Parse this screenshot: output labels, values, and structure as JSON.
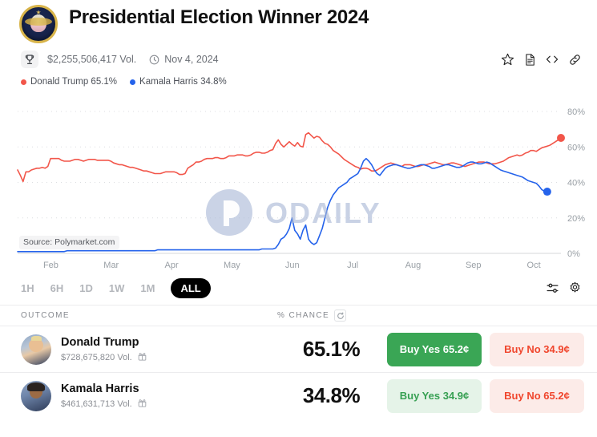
{
  "header": {
    "logo_icon": "presidential-seal-icon",
    "title": "Presidential Election Winner 2024"
  },
  "meta": {
    "trophy_icon": "trophy-icon",
    "volume": "$2,255,506,417 Vol.",
    "clock_icon": "clock-icon",
    "date": "Nov 4, 2024",
    "actions": [
      {
        "name": "star-icon",
        "label": "star"
      },
      {
        "name": "document-icon",
        "label": "document"
      },
      {
        "name": "code-icon",
        "label": "embed"
      },
      {
        "name": "link-icon",
        "label": "link"
      }
    ]
  },
  "legend": [
    {
      "label": "Donald Trump 65.1%",
      "color": "#f2564a"
    },
    {
      "label": "Kamala Harris 34.8%",
      "color": "#2563eb"
    }
  ],
  "chart_data": {
    "type": "line",
    "title": "",
    "xlabel": "",
    "ylabel": "",
    "ylim": [
      0,
      85
    ],
    "ytick_labels": [
      "0%",
      "20%",
      "40%",
      "60%",
      "80%"
    ],
    "ytick_values": [
      0,
      20,
      40,
      60,
      80
    ],
    "xtick_labels": [
      "Feb",
      "Mar",
      "Apr",
      "May",
      "Jun",
      "Jul",
      "Aug",
      "Sep",
      "Oct"
    ],
    "grid": "dotted-horizontal",
    "legend_position": "above-chart",
    "source_note": "Source: Polymarket.com",
    "watermark": "ODAILY",
    "series": [
      {
        "name": "Donald Trump",
        "color": "#f2564a",
        "end_value": 65.1,
        "values": [
          47,
          44,
          40.5,
          46,
          46,
          47,
          47.5,
          48,
          48,
          48.5,
          48,
          49,
          53.5,
          53.5,
          53.5,
          53.5,
          52.5,
          52,
          52,
          52,
          52.5,
          53,
          53,
          52.5,
          52,
          52.5,
          53,
          53,
          53,
          52.5,
          52.5,
          52.5,
          52.5,
          52.5,
          52,
          51,
          50.5,
          50,
          50,
          49.5,
          49,
          48.5,
          48.5,
          48,
          47.5,
          47,
          46.5,
          46.5,
          46,
          45.5,
          45,
          45,
          45,
          45.5,
          46,
          46,
          46,
          46,
          45.5,
          44.5,
          44.5,
          45,
          48,
          49,
          50,
          51.5,
          51.5,
          52,
          53,
          53.5,
          53.5,
          53.5,
          54,
          54,
          53.5,
          53.5,
          54,
          55,
          55,
          55,
          55.5,
          55.5,
          55.5,
          55,
          55,
          55.5,
          56.5,
          57,
          57,
          56.5,
          56.5,
          57,
          58,
          58.5,
          62,
          64,
          61.5,
          60,
          61.5,
          63,
          61.5,
          60.5,
          62.5,
          60.5,
          60,
          67,
          68,
          66.5,
          65,
          66,
          65.5,
          63.5,
          62,
          61.5,
          60,
          58,
          57,
          56,
          54.5,
          53,
          52,
          51,
          50,
          49,
          48.5,
          47.5,
          48,
          48,
          47.5,
          46.5,
          46.5,
          47,
          48,
          49,
          50,
          50.5,
          51,
          50.5,
          50,
          49.5,
          49,
          50,
          50,
          50,
          49.5,
          49,
          49,
          49.5,
          50,
          50,
          50.5,
          51,
          51.5,
          51,
          50.5,
          50,
          50,
          50.5,
          51,
          51,
          50.5,
          50,
          49.5,
          49,
          49.5,
          50,
          50.5,
          51,
          51.5,
          51.5,
          51.5,
          51,
          50.5,
          50.5,
          50.5,
          51,
          51.5,
          52,
          53,
          54,
          54.5,
          55,
          55.5,
          55,
          55.5,
          56.5,
          57,
          58,
          58,
          57.5,
          58.5,
          59.5,
          60,
          60.5,
          61,
          62,
          63,
          64,
          65.1
        ]
      },
      {
        "name": "Kamala Harris",
        "color": "#2563eb",
        "end_value": 34.8,
        "values": [
          1,
          1,
          1,
          1,
          1,
          1,
          1,
          1,
          1,
          1,
          1,
          1,
          1,
          1,
          1,
          1,
          1,
          1,
          1.5,
          1.5,
          1.5,
          1.5,
          1.5,
          1.5,
          1.5,
          1.5,
          1.5,
          1.5,
          1.5,
          1.5,
          1.5,
          1.5,
          1.5,
          1.5,
          1.5,
          1.5,
          1.5,
          1.5,
          1.5,
          1.5,
          1.5,
          1.5,
          1.5,
          1.5,
          1.5,
          1.5,
          1.5,
          1.5,
          1.5,
          1.5,
          1.5,
          2,
          2,
          2,
          2,
          2,
          2,
          2,
          2,
          2,
          2,
          2,
          2,
          2,
          2,
          2,
          2,
          2,
          2,
          2,
          2,
          2,
          2,
          2,
          2,
          2,
          2,
          2,
          2,
          2,
          2,
          2,
          2,
          2,
          2,
          2,
          2,
          2,
          2,
          2.5,
          2.5,
          2.5,
          2.5,
          2.5,
          3,
          5,
          8,
          9,
          11,
          14,
          20,
          13,
          11,
          8,
          13,
          16,
          8,
          6,
          5,
          6,
          10,
          14,
          20,
          26,
          30,
          33,
          35,
          37,
          38,
          39,
          40,
          42,
          43,
          44,
          45,
          48,
          52,
          53.5,
          52,
          50,
          47,
          45,
          44,
          46,
          48,
          49,
          49.5,
          50,
          50,
          49.5,
          49,
          48.5,
          48,
          48,
          48.5,
          49,
          49.5,
          50,
          50,
          49.5,
          49,
          48,
          48,
          48.5,
          49,
          49.5,
          50,
          50,
          49.5,
          49,
          48.5,
          48.5,
          49,
          50,
          51,
          51.5,
          51.5,
          51,
          50.5,
          50.5,
          51,
          51.5,
          51,
          50,
          49,
          48,
          47,
          46.5,
          46,
          45.5,
          45,
          44.5,
          44,
          43.5,
          43,
          42,
          41,
          40.5,
          40,
          39.5,
          38,
          36,
          35,
          34.8
        ]
      }
    ]
  },
  "ranges": {
    "buttons": [
      "1H",
      "6H",
      "1D",
      "1W",
      "1M",
      "ALL"
    ],
    "active": "ALL",
    "sliders_icon": "sliders-icon",
    "gear_icon": "gear-icon"
  },
  "table": {
    "col_outcome": "OUTCOME",
    "col_chance": "% CHANCE",
    "refresh_icon": "refresh-icon",
    "rows": [
      {
        "avatar_icon": "donald-trump-avatar",
        "name": "Donald Trump",
        "volume": "$728,675,820 Vol.",
        "gift_icon": "gift-icon",
        "percent": "65.1%",
        "buy_yes": "Buy Yes 65.2¢",
        "buy_no": "Buy No 34.9¢",
        "yes_style": "solid"
      },
      {
        "avatar_icon": "kamala-harris-avatar",
        "name": "Kamala Harris",
        "volume": "$461,631,713 Vol.",
        "gift_icon": "gift-icon",
        "percent": "34.8%",
        "buy_yes": "Buy Yes 34.9¢",
        "buy_no": "Buy No 65.2¢",
        "yes_style": "soft"
      }
    ]
  },
  "colors": {
    "trump_red": "#f2564a",
    "harris_blue": "#2563eb",
    "green": "#3aa655",
    "green_soft_bg": "#e5f3e8",
    "red_soft_bg": "#fcebe8",
    "red_text": "#f0462d"
  }
}
